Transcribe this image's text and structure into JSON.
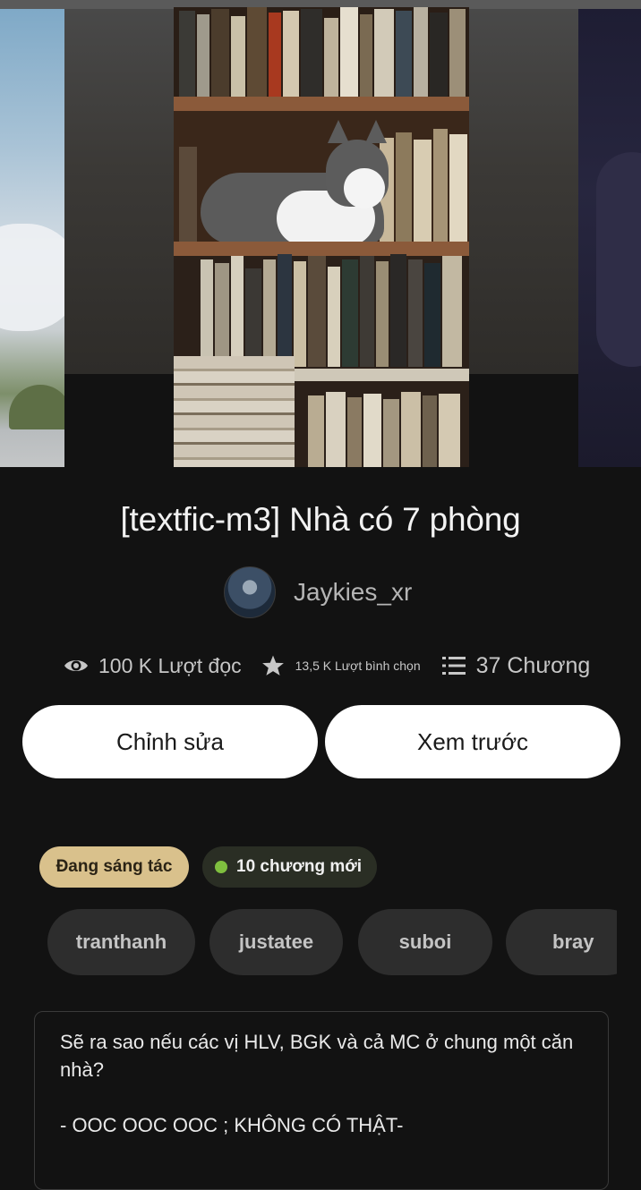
{
  "story": {
    "title": "[textfic-m3] Nhà có 7 phòng",
    "author": "Jaykies_xr"
  },
  "stats": {
    "reads": "100 K Lượt đọc",
    "votes": "13,5 K Lượt bình chọn",
    "chapters": "37 Chương"
  },
  "actions": {
    "edit_label": "Chỉnh sửa",
    "preview_label": "Xem trước"
  },
  "badges": {
    "status": "Đang sáng tác",
    "new_chapters": "10 chương mới"
  },
  "tags": [
    "tranthanh",
    "justatee",
    "suboi",
    "bray"
  ],
  "description": {
    "line1": "Sẽ ra sao nếu các vị HLV, BGK và cả MC ở chung một căn nhà?",
    "line2": "- OOC OOC OOC ; KHÔNG CÓ THẬT-"
  },
  "icons": {
    "reads": "eye-icon",
    "votes": "star-icon",
    "chapters": "list-icon"
  },
  "colors": {
    "background": "#121212",
    "status_badge": "#d9c18c",
    "new_dot": "#7fbf3f",
    "button": "#ffffff"
  }
}
